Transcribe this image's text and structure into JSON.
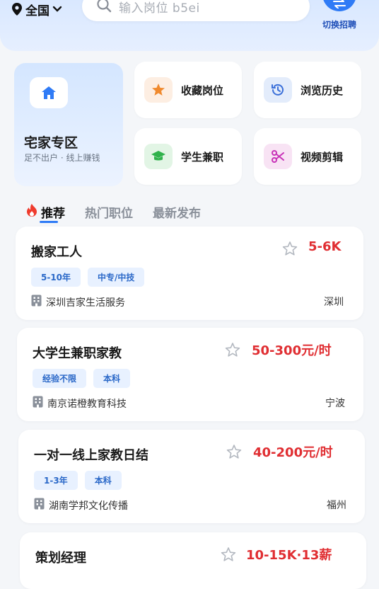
{
  "header": {
    "location": "全国",
    "search_placeholder": "输入岗位 b5ei",
    "switch_label": "切换招聘"
  },
  "home_card": {
    "title": "宅家专区",
    "subtitle": "足不出户 · 线上赚钱"
  },
  "features": [
    {
      "label": "收藏岗位",
      "icon": "star-icon",
      "color": "#f08a2e"
    },
    {
      "label": "浏览历史",
      "icon": "history-icon",
      "color": "#3a6fd9"
    },
    {
      "label": "学生兼职",
      "icon": "graduation-cap-icon",
      "color": "#2fb24b"
    },
    {
      "label": "视频剪辑",
      "icon": "scissors-icon",
      "color": "#c832b8"
    }
  ],
  "tabs": [
    {
      "label": "推荐",
      "active": true
    },
    {
      "label": "热门职位",
      "active": false
    },
    {
      "label": "最新发布",
      "active": false
    }
  ],
  "jobs": [
    {
      "title": "搬家工人",
      "salary": "5-6K",
      "tags": [
        "5-10年",
        "中专/中技"
      ],
      "company": "深圳吉家生活服务",
      "city": "深圳"
    },
    {
      "title": "大学生兼职家教",
      "salary": "50-300元/时",
      "tags": [
        "经验不限",
        "本科"
      ],
      "company": "南京诺橙教育科技",
      "city": "宁波"
    },
    {
      "title": "一对一线上家教日结",
      "salary": "40-200元/时",
      "tags": [
        "1-3年",
        "本科"
      ],
      "company": "湖南学邦文化传播",
      "city": "福州"
    },
    {
      "title": "策划经理",
      "salary": "10-15K·13薪"
    }
  ],
  "colors": {
    "accent": "#2f7bf6",
    "salary": "#e02e32",
    "tag_bg": "#e8f1ff"
  }
}
